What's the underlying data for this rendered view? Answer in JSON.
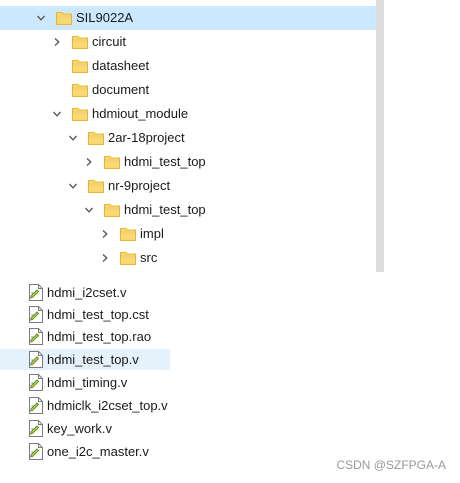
{
  "folder_tree": {
    "rows": [
      {
        "label": "SIL9022A",
        "chevron": "chevron-down-icon",
        "selected": true
      },
      {
        "label": "circuit",
        "chevron": "chevron-right-icon",
        "selected": false
      },
      {
        "label": "datasheet",
        "chevron": "",
        "selected": false
      },
      {
        "label": "document",
        "chevron": "",
        "selected": false
      },
      {
        "label": "hdmiout_module",
        "chevron": "chevron-down-icon",
        "selected": false
      },
      {
        "label": "2ar-18project",
        "chevron": "chevron-down-icon",
        "selected": false
      },
      {
        "label": "hdmi_test_top",
        "chevron": "chevron-right-icon",
        "selected": false
      },
      {
        "label": "nr-9project",
        "chevron": "chevron-down-icon",
        "selected": false
      },
      {
        "label": "hdmi_test_top",
        "chevron": "chevron-down-icon",
        "selected": false
      },
      {
        "label": "impl",
        "chevron": "chevron-right-icon",
        "selected": false
      },
      {
        "label": "src",
        "chevron": "chevron-right-icon",
        "selected": false
      }
    ]
  },
  "file_list": {
    "files": [
      {
        "name": "hdmi_i2cset.v",
        "highlighted": false
      },
      {
        "name": "hdmi_test_top.cst",
        "highlighted": false
      },
      {
        "name": "hdmi_test_top.rao",
        "highlighted": false
      },
      {
        "name": "hdmi_test_top.v",
        "highlighted": true
      },
      {
        "name": "hdmi_timing.v",
        "highlighted": false
      },
      {
        "name": "hdmiclk_i2cset_top.v",
        "highlighted": false
      },
      {
        "name": "key_work.v",
        "highlighted": false
      },
      {
        "name": "one_i2c_master.v",
        "highlighted": false
      }
    ]
  },
  "watermark": "CSDN @SZFPGA-A",
  "colors": {
    "selection": "#cce8ff",
    "hover": "#e5f1fb",
    "folder": "#f8d775",
    "folder_dark": "#e7b73a",
    "chevron": "#555555",
    "watermark": "#9a9a9a"
  }
}
